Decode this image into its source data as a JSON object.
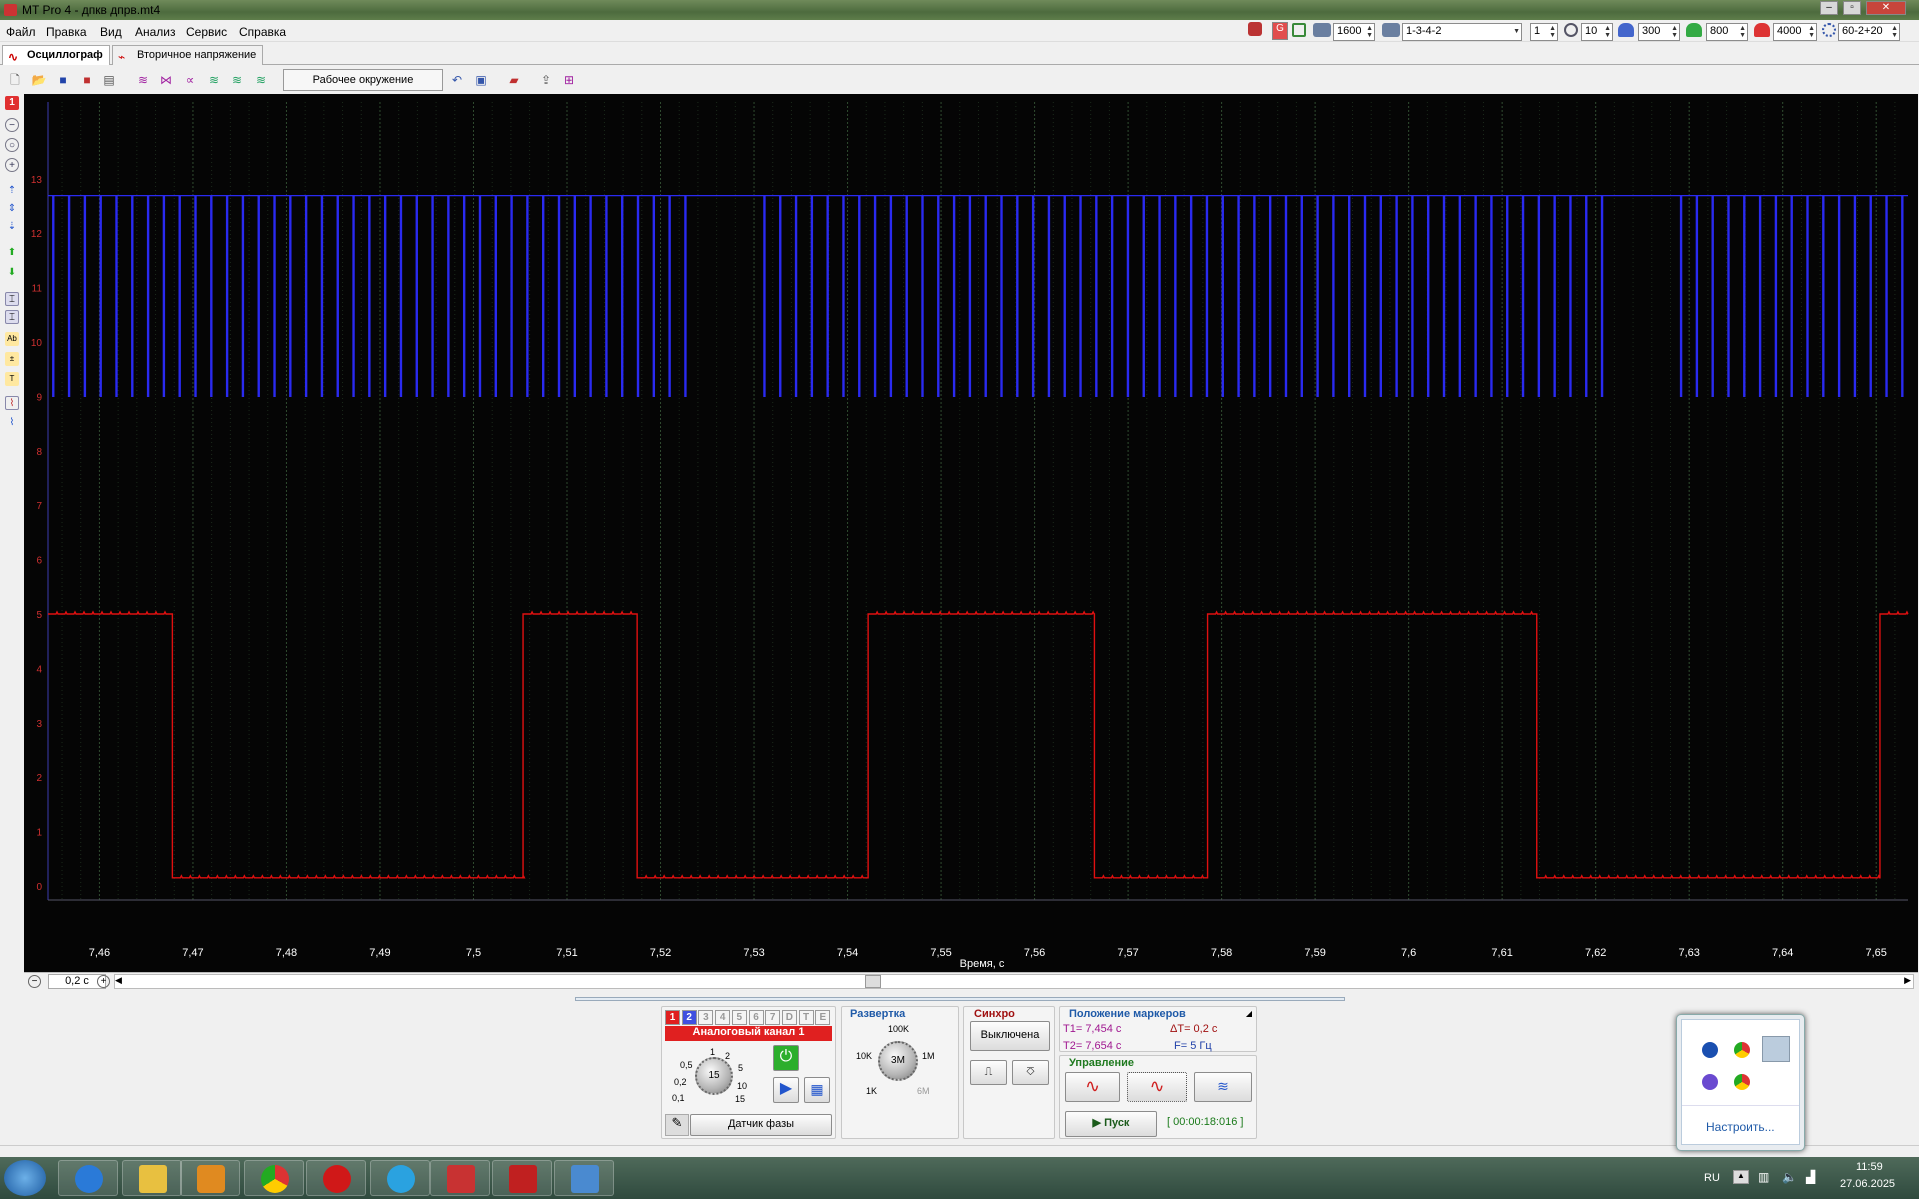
{
  "window": {
    "title": "MT Pro 4 - дпкв дпрв.mt4"
  },
  "menu": [
    "Файл",
    "Правка",
    "Вид",
    "Анализ",
    "Сервис",
    "Справка"
  ],
  "tabs": [
    {
      "label": "Осциллограф"
    },
    {
      "label": "Вторичное напряжение"
    }
  ],
  "toolbar": {
    "environment_label": "Рабочее окружение"
  },
  "topright": {
    "rpm": "1600",
    "firing_order": "1-3-4-2",
    "cylinder": "1",
    "value_a": "10",
    "value_b": "300",
    "value_c": "800",
    "value_d": "4000",
    "angle": "60-2+20"
  },
  "plot": {
    "xlabel": "Время, с",
    "x_ticks": [
      "7,46",
      "7,47",
      "7,48",
      "7,49",
      "7,5",
      "7,51",
      "7,52",
      "7,53",
      "7,54",
      "7,55",
      "7,56",
      "7,57",
      "7,58",
      "7,59",
      "7,6",
      "7,61",
      "7,62",
      "7,63",
      "7,64",
      "7,65"
    ],
    "y_ticks": [
      "0",
      "1",
      "2",
      "3",
      "4",
      "5",
      "6",
      "7",
      "8",
      "9",
      "10",
      "11",
      "12",
      "13"
    ],
    "colors": {
      "ch1": "#e01010",
      "ch2": "#2a2af0",
      "grid": "#2c3a2c",
      "bg": "#050505"
    }
  },
  "chart_data": {
    "type": "line",
    "xlabel": "Время, с",
    "ylabel": "",
    "xlim": [
      7.4545,
      7.6534
    ],
    "series": [
      {
        "channel": "1",
        "high": 5.0,
        "low": 0.15,
        "segments": [
          {
            "from": 7.4545,
            "to": 7.4678,
            "level": "high"
          },
          {
            "from": 7.4678,
            "to": 7.5053,
            "level": "low"
          },
          {
            "from": 7.5053,
            "to": 7.5175,
            "level": "high"
          },
          {
            "from": 7.5175,
            "to": 7.5422,
            "level": "low"
          },
          {
            "from": 7.5422,
            "to": 7.5664,
            "level": "high"
          },
          {
            "from": 7.5664,
            "to": 7.5785,
            "level": "low"
          },
          {
            "from": 7.5785,
            "to": 7.6137,
            "level": "high"
          },
          {
            "from": 7.6137,
            "to": 7.6504,
            "level": "low"
          },
          {
            "from": 7.6504,
            "to": 7.6534,
            "level": "high"
          }
        ]
      },
      {
        "channel": "2",
        "high": 12.7,
        "low": 9.0,
        "pulse_period": 0.00169,
        "gaps": [
          [
            7.5229,
            7.5308
          ],
          [
            7.6219,
            7.6276
          ]
        ]
      }
    ]
  },
  "scale": {
    "timebase": "0,2 с"
  },
  "channel_panel": {
    "tabs": [
      "1",
      "2",
      "3",
      "4",
      "5",
      "6",
      "7",
      "D",
      "T",
      "E"
    ],
    "name": "Аналоговый канал 1",
    "knob_value": "15",
    "knob_labels": [
      "0,1",
      "0,2",
      "0,5",
      "1",
      "2",
      "5",
      "10",
      "15"
    ],
    "sensor": "Датчик фазы"
  },
  "sweep": {
    "title": "Развертка",
    "knob_value": "3M",
    "labels": [
      "100K",
      "10K",
      "1M",
      "1K",
      "6M"
    ]
  },
  "sync": {
    "title": "Синхро",
    "state": "Выключена"
  },
  "markers": {
    "title": "Положение маркеров",
    "t1": "T1= 7,454 с",
    "t2": "T2= 7,654 с",
    "dt": "ΔT= 0,2 с",
    "f": "F= 5 Гц"
  },
  "control": {
    "title": "Управление",
    "start": "Пуск",
    "elapsed": "[ 00:00:18:016 ]"
  },
  "tray": {
    "customize": "Настроить..."
  },
  "taskbar": {
    "lang": "RU",
    "time": "11:59",
    "date": "27.06.2025"
  }
}
